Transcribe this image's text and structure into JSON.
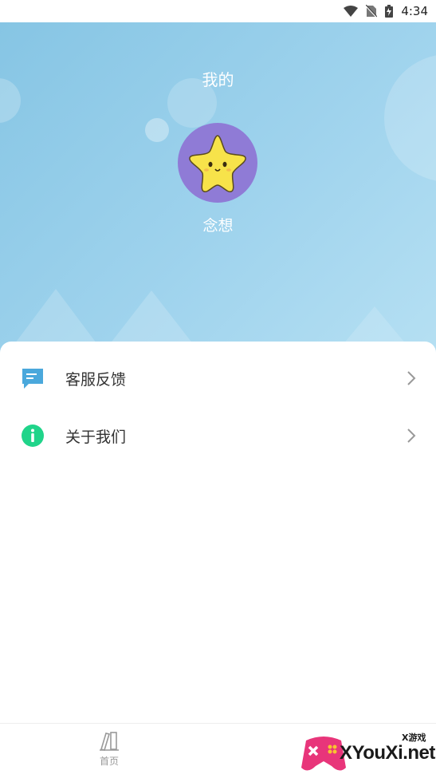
{
  "status_bar": {
    "time": "4:34"
  },
  "header": {
    "title": "我的"
  },
  "profile": {
    "username": "念想"
  },
  "menu": {
    "items": [
      {
        "label": "客服反馈",
        "icon": "chat-bubble-icon",
        "color": "#4aa8dc"
      },
      {
        "label": "关于我们",
        "icon": "info-icon",
        "color": "#20d48a"
      }
    ]
  },
  "bottom_nav": {
    "home_label": "首页"
  },
  "watermark": {
    "text": "XYouXi.net",
    "sub": "X游戏"
  }
}
